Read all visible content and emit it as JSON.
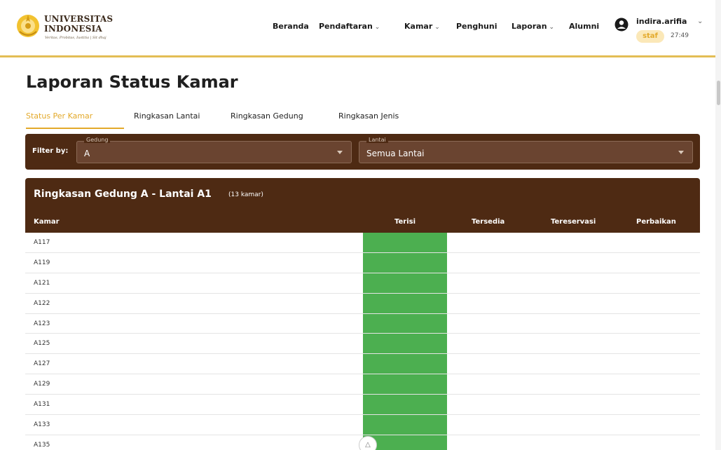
{
  "header": {
    "logo": {
      "line1": "UNIVERSITAS",
      "line2": "INDONESIA",
      "tagline": "Veritas, Probitas, Iustitia | Sit dhaj"
    },
    "nav": [
      {
        "label": "Beranda",
        "dropdown": false
      },
      {
        "label": "Pendaftaran",
        "dropdown": true
      },
      {
        "label": "Kamar",
        "dropdown": true
      },
      {
        "label": "Penghuni",
        "dropdown": false
      },
      {
        "label": "Laporan",
        "dropdown": true
      },
      {
        "label": "Alumni",
        "dropdown": false
      }
    ],
    "user": {
      "name": "indira.arifia",
      "role": "staf",
      "timer": "27:49"
    }
  },
  "page": {
    "title": "Laporan Status Kamar",
    "tabs": [
      {
        "label": "Status Per Kamar",
        "active": true
      },
      {
        "label": "Ringkasan Lantai",
        "active": false
      },
      {
        "label": "Ringkasan Gedung",
        "active": false
      },
      {
        "label": "Ringkasan Jenis",
        "active": false
      }
    ]
  },
  "filters": {
    "label": "Filter by:",
    "gedung": {
      "legend": "Gedung",
      "value": "A"
    },
    "lantai": {
      "legend": "Lantai",
      "value": "Semua Lantai"
    }
  },
  "summary": {
    "title": "Ringkasan Gedung A - Lantai A1",
    "count": "(13 kamar)",
    "columns": [
      "Kamar",
      "Terisi",
      "Tersedia",
      "Tereservasi",
      "Perbaikan"
    ],
    "rows": [
      "A117",
      "A119",
      "A121",
      "A122",
      "A123",
      "A125",
      "A127",
      "A129",
      "A131",
      "A133",
      "A135"
    ],
    "status_color": "#4caf50"
  },
  "colors": {
    "brand_brown": "#4e2a13",
    "accent_gold": "#e3a92a",
    "status_terisi": "#4caf50"
  }
}
